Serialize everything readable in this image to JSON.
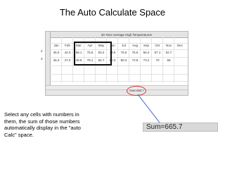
{
  "title": "The Auto Calculate Space",
  "spreadsheet": {
    "chart_title": "30 Year Average High Temperatures",
    "row_markers": [
      "2",
      "3"
    ],
    "headers": [
      "Jan",
      "Feb",
      "Mar",
      "Apr",
      "May",
      "Jun",
      "Jul",
      "Aug",
      "Sep",
      "Oct",
      "Nov",
      "Dec"
    ],
    "row1": [
      "35.0",
      "42.0",
      "68.1",
      "75.5",
      "83.2",
      "73.8",
      "75.6",
      "75.6",
      "65.4",
      "57.1",
      "52.7"
    ],
    "row2": [
      "45.3",
      "47.0",
      "49.9",
      "78.1",
      "84.7",
      "90.3",
      "80.2",
      "72.8",
      "73.2",
      "70",
      "65"
    ],
    "status_small": "Sum=665.7"
  },
  "caption": "Select any cells with numbers in them, the sum of those numbers automatically display in the \"auto Calc\" space.",
  "sum_display": "Sum=665.7",
  "colors": {
    "highlight": "#d93a3a",
    "connector": "#3a5fcd"
  }
}
